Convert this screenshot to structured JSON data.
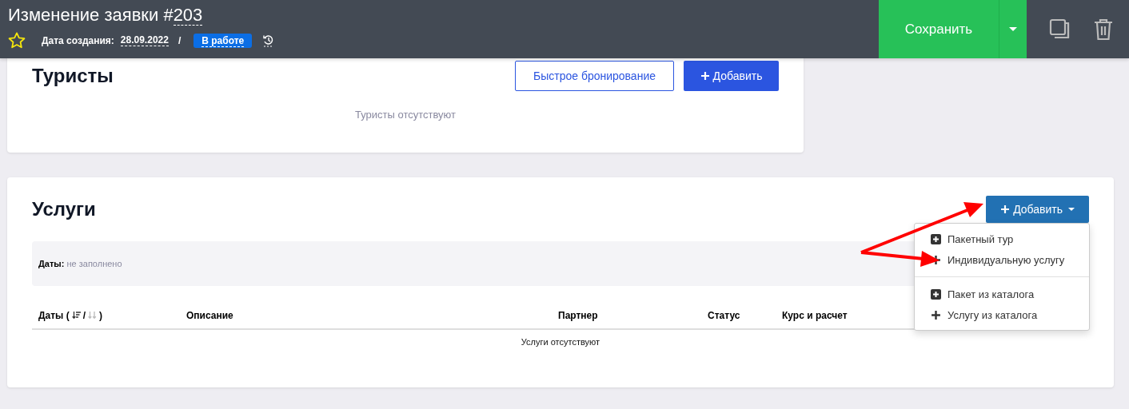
{
  "header": {
    "title": "Изменение заявки #",
    "number": "203",
    "favorite": false,
    "created_label": "Дата создания:",
    "created_date": "28.09.2022",
    "separator": "/",
    "status": "В работе",
    "save_button": "Сохранить"
  },
  "tourists": {
    "title": "Туристы",
    "quick_booking_button": "Быстрое бронирование",
    "add_button": "Добавить",
    "empty_text": "Туристы отсутствуют"
  },
  "services": {
    "title": "Услуги",
    "add_button": "Добавить",
    "filter_label": "Даты:",
    "filter_value": "не заполнено",
    "columns": [
      {
        "label": "Даты (",
        "sort": true,
        "close": ")"
      },
      {
        "label": "Описание"
      },
      {
        "label": "Партнер"
      },
      {
        "label": "Статус"
      },
      {
        "label": "Курс и расчет"
      }
    ],
    "sort_icons": [
      {
        "selected": true
      },
      {
        "selected": false
      }
    ],
    "sort_separator": "/",
    "empty_text": "Услуги отсутствуют",
    "menu": [
      [
        {
          "kind": "boxed-plus",
          "label": "Пакетный тур"
        },
        {
          "kind": "plus",
          "label": "Индивидуальную услугу"
        }
      ],
      [
        {
          "kind": "boxed-plus",
          "label": "Пакет из каталога"
        },
        {
          "kind": "plus",
          "label": "Услугу из каталога"
        }
      ]
    ]
  }
}
